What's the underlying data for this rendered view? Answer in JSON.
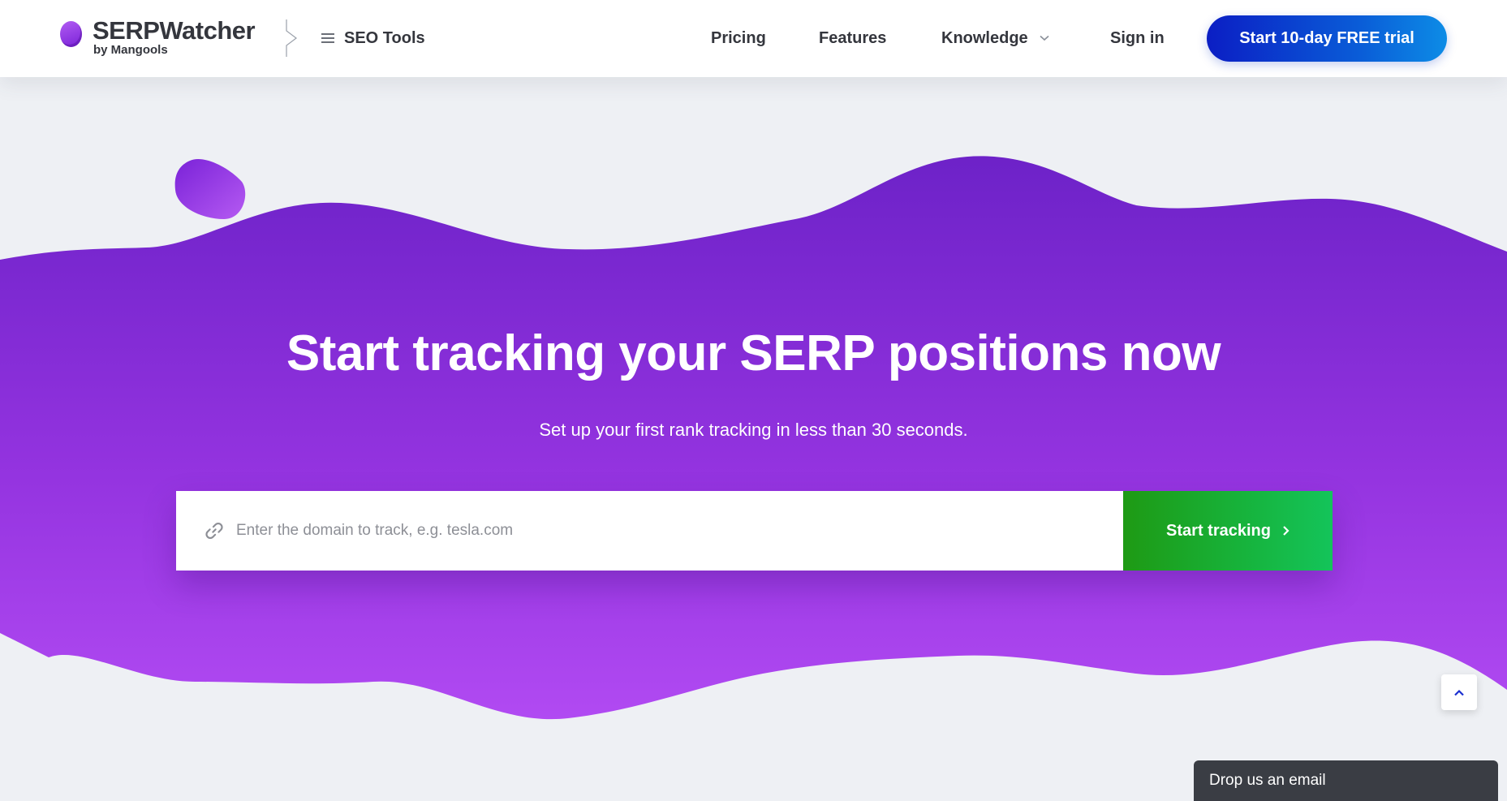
{
  "brand": {
    "name": "SERPWatcher",
    "sub": "by Mangools"
  },
  "header": {
    "seo_tools_label": "SEO Tools",
    "nav": {
      "pricing": "Pricing",
      "features": "Features",
      "knowledge": "Knowledge",
      "signin": "Sign in"
    },
    "cta_label": "Start 10-day FREE trial"
  },
  "hero": {
    "title": "Start tracking your SERP positions now",
    "subtitle": "Set up your first rank tracking in less than 30 seconds.",
    "search": {
      "value": "",
      "placeholder": "Enter the domain to track, e.g. tesla.com",
      "button_label": "Start tracking"
    }
  },
  "widgets": {
    "email_label": "Drop us an email"
  },
  "icons": {
    "logo": "purple-oval-logo",
    "menu": "hamburger-icon",
    "dropdown": "chevron-down-icon",
    "link": "link-icon",
    "button_arrow": "chevron-right-icon",
    "scroll_top": "chevron-up-icon"
  },
  "colors": {
    "brand_purple": "#7a22d8",
    "hero_purple_top": "#7224cc",
    "hero_purple_bottom": "#b14af2",
    "cta_blue": "#0b1ec4",
    "track_green": "#17b23a",
    "text_dark": "#34363d",
    "widget_dark": "#3a3d44"
  }
}
